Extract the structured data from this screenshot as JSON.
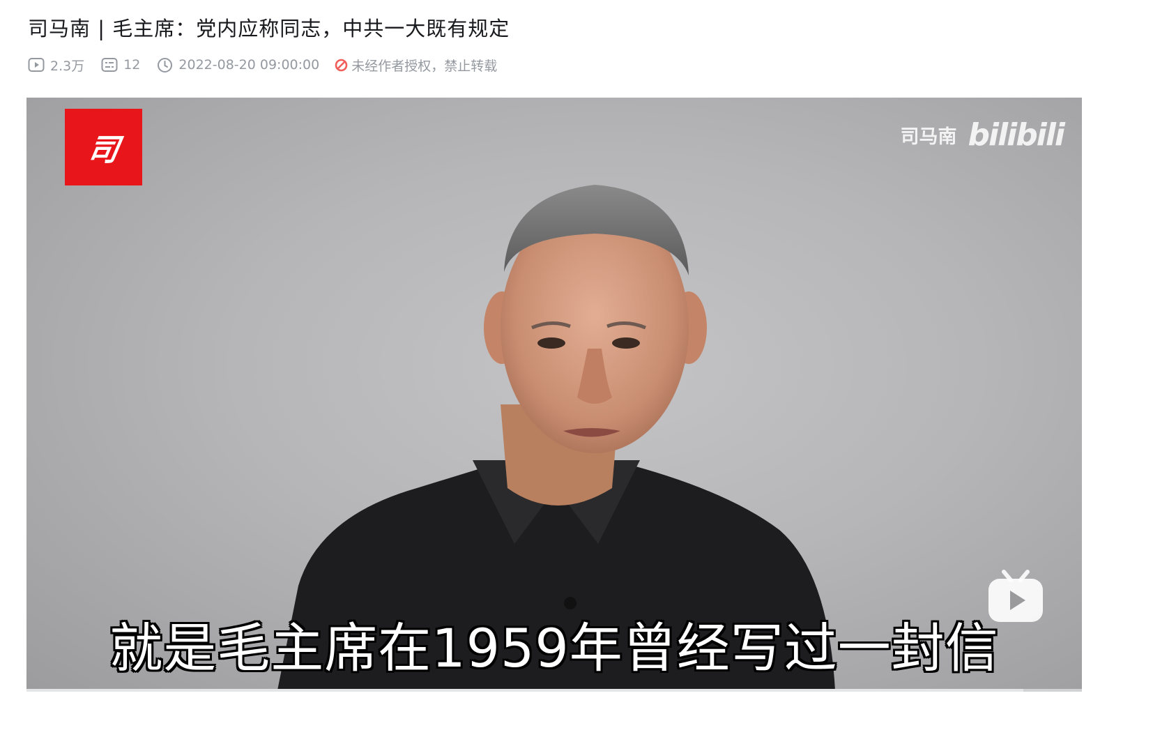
{
  "video": {
    "title": "司马南 | 毛主席：党内应称同志，中共一大既有规定",
    "views": "2.3万",
    "comments": "12",
    "publish_time": "2022-08-20 09:00:00",
    "copyright_notice": "未经作者授权，禁止转载"
  },
  "player": {
    "channel_logo_text": "司",
    "watermark_name": "司马南",
    "watermark_brand": "bilibili",
    "subtitle": "就是毛主席在1959年曾经写过一封信",
    "progress_percent": 0
  },
  "colors": {
    "title": "#18191c",
    "meta": "#9499a0",
    "warning": "#f25d59",
    "logo_bg": "#e8161a",
    "progress": "#00aeec"
  },
  "icons": {
    "views": "play-count-icon",
    "comments": "danmaku-icon",
    "time": "clock-icon",
    "copyright": "forbidden-icon",
    "player_corner": "bilibili-tv-icon"
  }
}
